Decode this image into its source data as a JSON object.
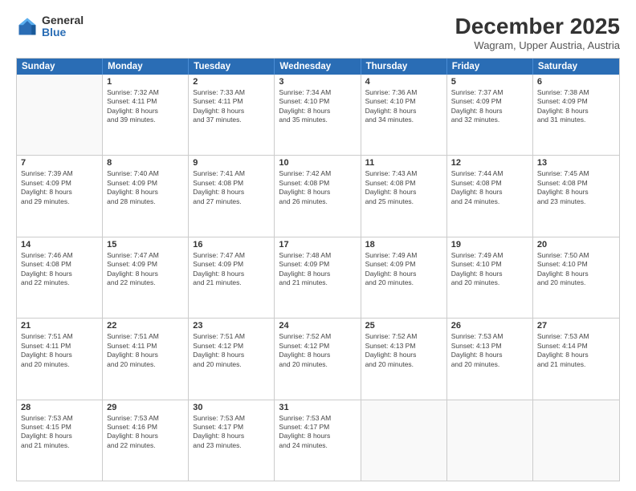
{
  "logo": {
    "general": "General",
    "blue": "Blue"
  },
  "title": "December 2025",
  "subtitle": "Wagram, Upper Austria, Austria",
  "header_days": [
    "Sunday",
    "Monday",
    "Tuesday",
    "Wednesday",
    "Thursday",
    "Friday",
    "Saturday"
  ],
  "weeks": [
    [
      {
        "day": "",
        "lines": []
      },
      {
        "day": "1",
        "lines": [
          "Sunrise: 7:32 AM",
          "Sunset: 4:11 PM",
          "Daylight: 8 hours",
          "and 39 minutes."
        ]
      },
      {
        "day": "2",
        "lines": [
          "Sunrise: 7:33 AM",
          "Sunset: 4:11 PM",
          "Daylight: 8 hours",
          "and 37 minutes."
        ]
      },
      {
        "day": "3",
        "lines": [
          "Sunrise: 7:34 AM",
          "Sunset: 4:10 PM",
          "Daylight: 8 hours",
          "and 35 minutes."
        ]
      },
      {
        "day": "4",
        "lines": [
          "Sunrise: 7:36 AM",
          "Sunset: 4:10 PM",
          "Daylight: 8 hours",
          "and 34 minutes."
        ]
      },
      {
        "day": "5",
        "lines": [
          "Sunrise: 7:37 AM",
          "Sunset: 4:09 PM",
          "Daylight: 8 hours",
          "and 32 minutes."
        ]
      },
      {
        "day": "6",
        "lines": [
          "Sunrise: 7:38 AM",
          "Sunset: 4:09 PM",
          "Daylight: 8 hours",
          "and 31 minutes."
        ]
      }
    ],
    [
      {
        "day": "7",
        "lines": [
          "Sunrise: 7:39 AM",
          "Sunset: 4:09 PM",
          "Daylight: 8 hours",
          "and 29 minutes."
        ]
      },
      {
        "day": "8",
        "lines": [
          "Sunrise: 7:40 AM",
          "Sunset: 4:09 PM",
          "Daylight: 8 hours",
          "and 28 minutes."
        ]
      },
      {
        "day": "9",
        "lines": [
          "Sunrise: 7:41 AM",
          "Sunset: 4:08 PM",
          "Daylight: 8 hours",
          "and 27 minutes."
        ]
      },
      {
        "day": "10",
        "lines": [
          "Sunrise: 7:42 AM",
          "Sunset: 4:08 PM",
          "Daylight: 8 hours",
          "and 26 minutes."
        ]
      },
      {
        "day": "11",
        "lines": [
          "Sunrise: 7:43 AM",
          "Sunset: 4:08 PM",
          "Daylight: 8 hours",
          "and 25 minutes."
        ]
      },
      {
        "day": "12",
        "lines": [
          "Sunrise: 7:44 AM",
          "Sunset: 4:08 PM",
          "Daylight: 8 hours",
          "and 24 minutes."
        ]
      },
      {
        "day": "13",
        "lines": [
          "Sunrise: 7:45 AM",
          "Sunset: 4:08 PM",
          "Daylight: 8 hours",
          "and 23 minutes."
        ]
      }
    ],
    [
      {
        "day": "14",
        "lines": [
          "Sunrise: 7:46 AM",
          "Sunset: 4:08 PM",
          "Daylight: 8 hours",
          "and 22 minutes."
        ]
      },
      {
        "day": "15",
        "lines": [
          "Sunrise: 7:47 AM",
          "Sunset: 4:09 PM",
          "Daylight: 8 hours",
          "and 22 minutes."
        ]
      },
      {
        "day": "16",
        "lines": [
          "Sunrise: 7:47 AM",
          "Sunset: 4:09 PM",
          "Daylight: 8 hours",
          "and 21 minutes."
        ]
      },
      {
        "day": "17",
        "lines": [
          "Sunrise: 7:48 AM",
          "Sunset: 4:09 PM",
          "Daylight: 8 hours",
          "and 21 minutes."
        ]
      },
      {
        "day": "18",
        "lines": [
          "Sunrise: 7:49 AM",
          "Sunset: 4:09 PM",
          "Daylight: 8 hours",
          "and 20 minutes."
        ]
      },
      {
        "day": "19",
        "lines": [
          "Sunrise: 7:49 AM",
          "Sunset: 4:10 PM",
          "Daylight: 8 hours",
          "and 20 minutes."
        ]
      },
      {
        "day": "20",
        "lines": [
          "Sunrise: 7:50 AM",
          "Sunset: 4:10 PM",
          "Daylight: 8 hours",
          "and 20 minutes."
        ]
      }
    ],
    [
      {
        "day": "21",
        "lines": [
          "Sunrise: 7:51 AM",
          "Sunset: 4:11 PM",
          "Daylight: 8 hours",
          "and 20 minutes."
        ]
      },
      {
        "day": "22",
        "lines": [
          "Sunrise: 7:51 AM",
          "Sunset: 4:11 PM",
          "Daylight: 8 hours",
          "and 20 minutes."
        ]
      },
      {
        "day": "23",
        "lines": [
          "Sunrise: 7:51 AM",
          "Sunset: 4:12 PM",
          "Daylight: 8 hours",
          "and 20 minutes."
        ]
      },
      {
        "day": "24",
        "lines": [
          "Sunrise: 7:52 AM",
          "Sunset: 4:12 PM",
          "Daylight: 8 hours",
          "and 20 minutes."
        ]
      },
      {
        "day": "25",
        "lines": [
          "Sunrise: 7:52 AM",
          "Sunset: 4:13 PM",
          "Daylight: 8 hours",
          "and 20 minutes."
        ]
      },
      {
        "day": "26",
        "lines": [
          "Sunrise: 7:53 AM",
          "Sunset: 4:13 PM",
          "Daylight: 8 hours",
          "and 20 minutes."
        ]
      },
      {
        "day": "27",
        "lines": [
          "Sunrise: 7:53 AM",
          "Sunset: 4:14 PM",
          "Daylight: 8 hours",
          "and 21 minutes."
        ]
      }
    ],
    [
      {
        "day": "28",
        "lines": [
          "Sunrise: 7:53 AM",
          "Sunset: 4:15 PM",
          "Daylight: 8 hours",
          "and 21 minutes."
        ]
      },
      {
        "day": "29",
        "lines": [
          "Sunrise: 7:53 AM",
          "Sunset: 4:16 PM",
          "Daylight: 8 hours",
          "and 22 minutes."
        ]
      },
      {
        "day": "30",
        "lines": [
          "Sunrise: 7:53 AM",
          "Sunset: 4:17 PM",
          "Daylight: 8 hours",
          "and 23 minutes."
        ]
      },
      {
        "day": "31",
        "lines": [
          "Sunrise: 7:53 AM",
          "Sunset: 4:17 PM",
          "Daylight: 8 hours",
          "and 24 minutes."
        ]
      },
      {
        "day": "",
        "lines": []
      },
      {
        "day": "",
        "lines": []
      },
      {
        "day": "",
        "lines": []
      }
    ]
  ]
}
